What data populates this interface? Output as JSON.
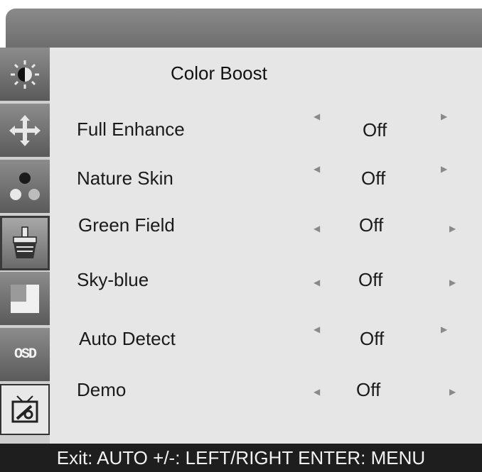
{
  "menu": {
    "title": "Color Boost",
    "rows": [
      {
        "label": "Full Enhance",
        "value": "Off"
      },
      {
        "label": "Nature Skin",
        "value": "Off"
      },
      {
        "label": "Green Field",
        "value": "Off"
      },
      {
        "label": "Sky-blue",
        "value": "Off"
      },
      {
        "label": "Auto Detect",
        "value": "Off"
      },
      {
        "label": "Demo",
        "value": "Off"
      }
    ]
  },
  "sidebar": {
    "tabs": [
      {
        "icon": "brightness-icon"
      },
      {
        "icon": "position-icon"
      },
      {
        "icon": "color-dots-icon"
      },
      {
        "icon": "color-boost-brush-icon",
        "active": true
      },
      {
        "icon": "picture-boost-icon"
      },
      {
        "icon": "osd-settings-icon",
        "text": "OSD"
      },
      {
        "icon": "setup-tools-icon"
      }
    ]
  },
  "footer": {
    "help_text": "Exit: AUTO +/-: LEFT/RIGHT ENTER: MENU"
  },
  "colors": {
    "panel_bg": "#e6e6e6",
    "sidebar_tab": "#6e6e6e",
    "footer_bg": "#1e1e1e"
  }
}
